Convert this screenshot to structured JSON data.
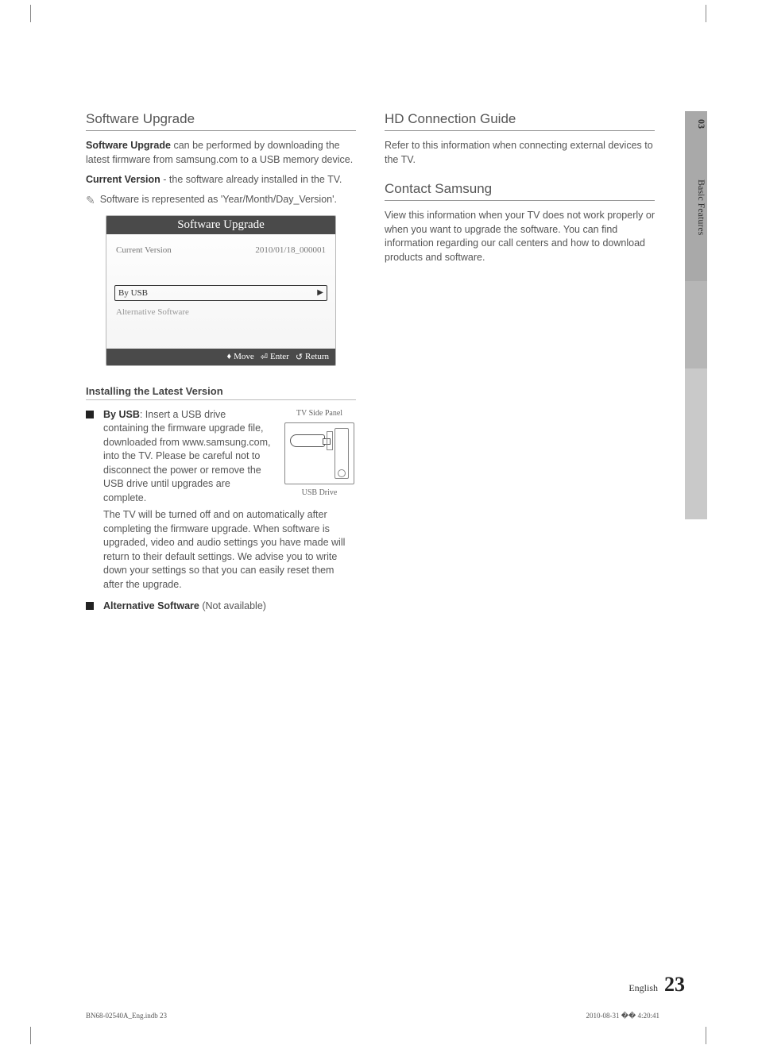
{
  "sideTab": {
    "chapter": "03",
    "section": "Basic Features"
  },
  "left": {
    "title": "Software Upgrade",
    "p1_bold": "Software Upgrade",
    "p1_rest": " can be performed by downloading the latest firmware from samsung.com to a USB memory device.",
    "p2_bold": "Current Version",
    "p2_rest": " - the software already installed in the TV.",
    "note": "Software is represented as 'Year/Month/Day_Version'.",
    "osd": {
      "title": "Software Upgrade",
      "row1_label": "Current Version",
      "row1_value": "2010/01/18_000001",
      "row_sel": "By USB",
      "row_dim": "Alternative Software",
      "nav_move": "Move",
      "nav_enter": "Enter",
      "nav_return": "Return"
    },
    "subheading": "Installing the Latest Version",
    "byusb_bold": "By USB",
    "byusb_text1": ": Insert a USB drive containing the firmware upgrade file, downloaded from www.samsung.com, into the TV. Please be careful not to disconnect the power or remove the USB drive until upgrades are complete.",
    "byusb_text2": "The TV will be turned off and on automatically after completing the firmware upgrade. When software is upgraded, video and audio settings you have made will return to their default settings. We advise you to write down your settings so that you can easily reset them after the upgrade.",
    "fig_top": "TV Side Panel",
    "fig_bottom": "USB Drive",
    "alt_bold": "Alternative Software",
    "alt_rest": " (Not available)"
  },
  "right": {
    "title1": "HD Connection Guide",
    "p1": "Refer to this information when connecting external devices to the TV.",
    "title2": "Contact Samsung",
    "p2": "View this information when your TV does not work properly or when you want to upgrade the software. You can find information regarding our call centers and how to download products and software."
  },
  "footer": {
    "lang": "English",
    "page": "23"
  },
  "meta": {
    "left": "BN68-02540A_Eng.indb   23",
    "right": "2010-08-31   �� 4:20:41"
  }
}
